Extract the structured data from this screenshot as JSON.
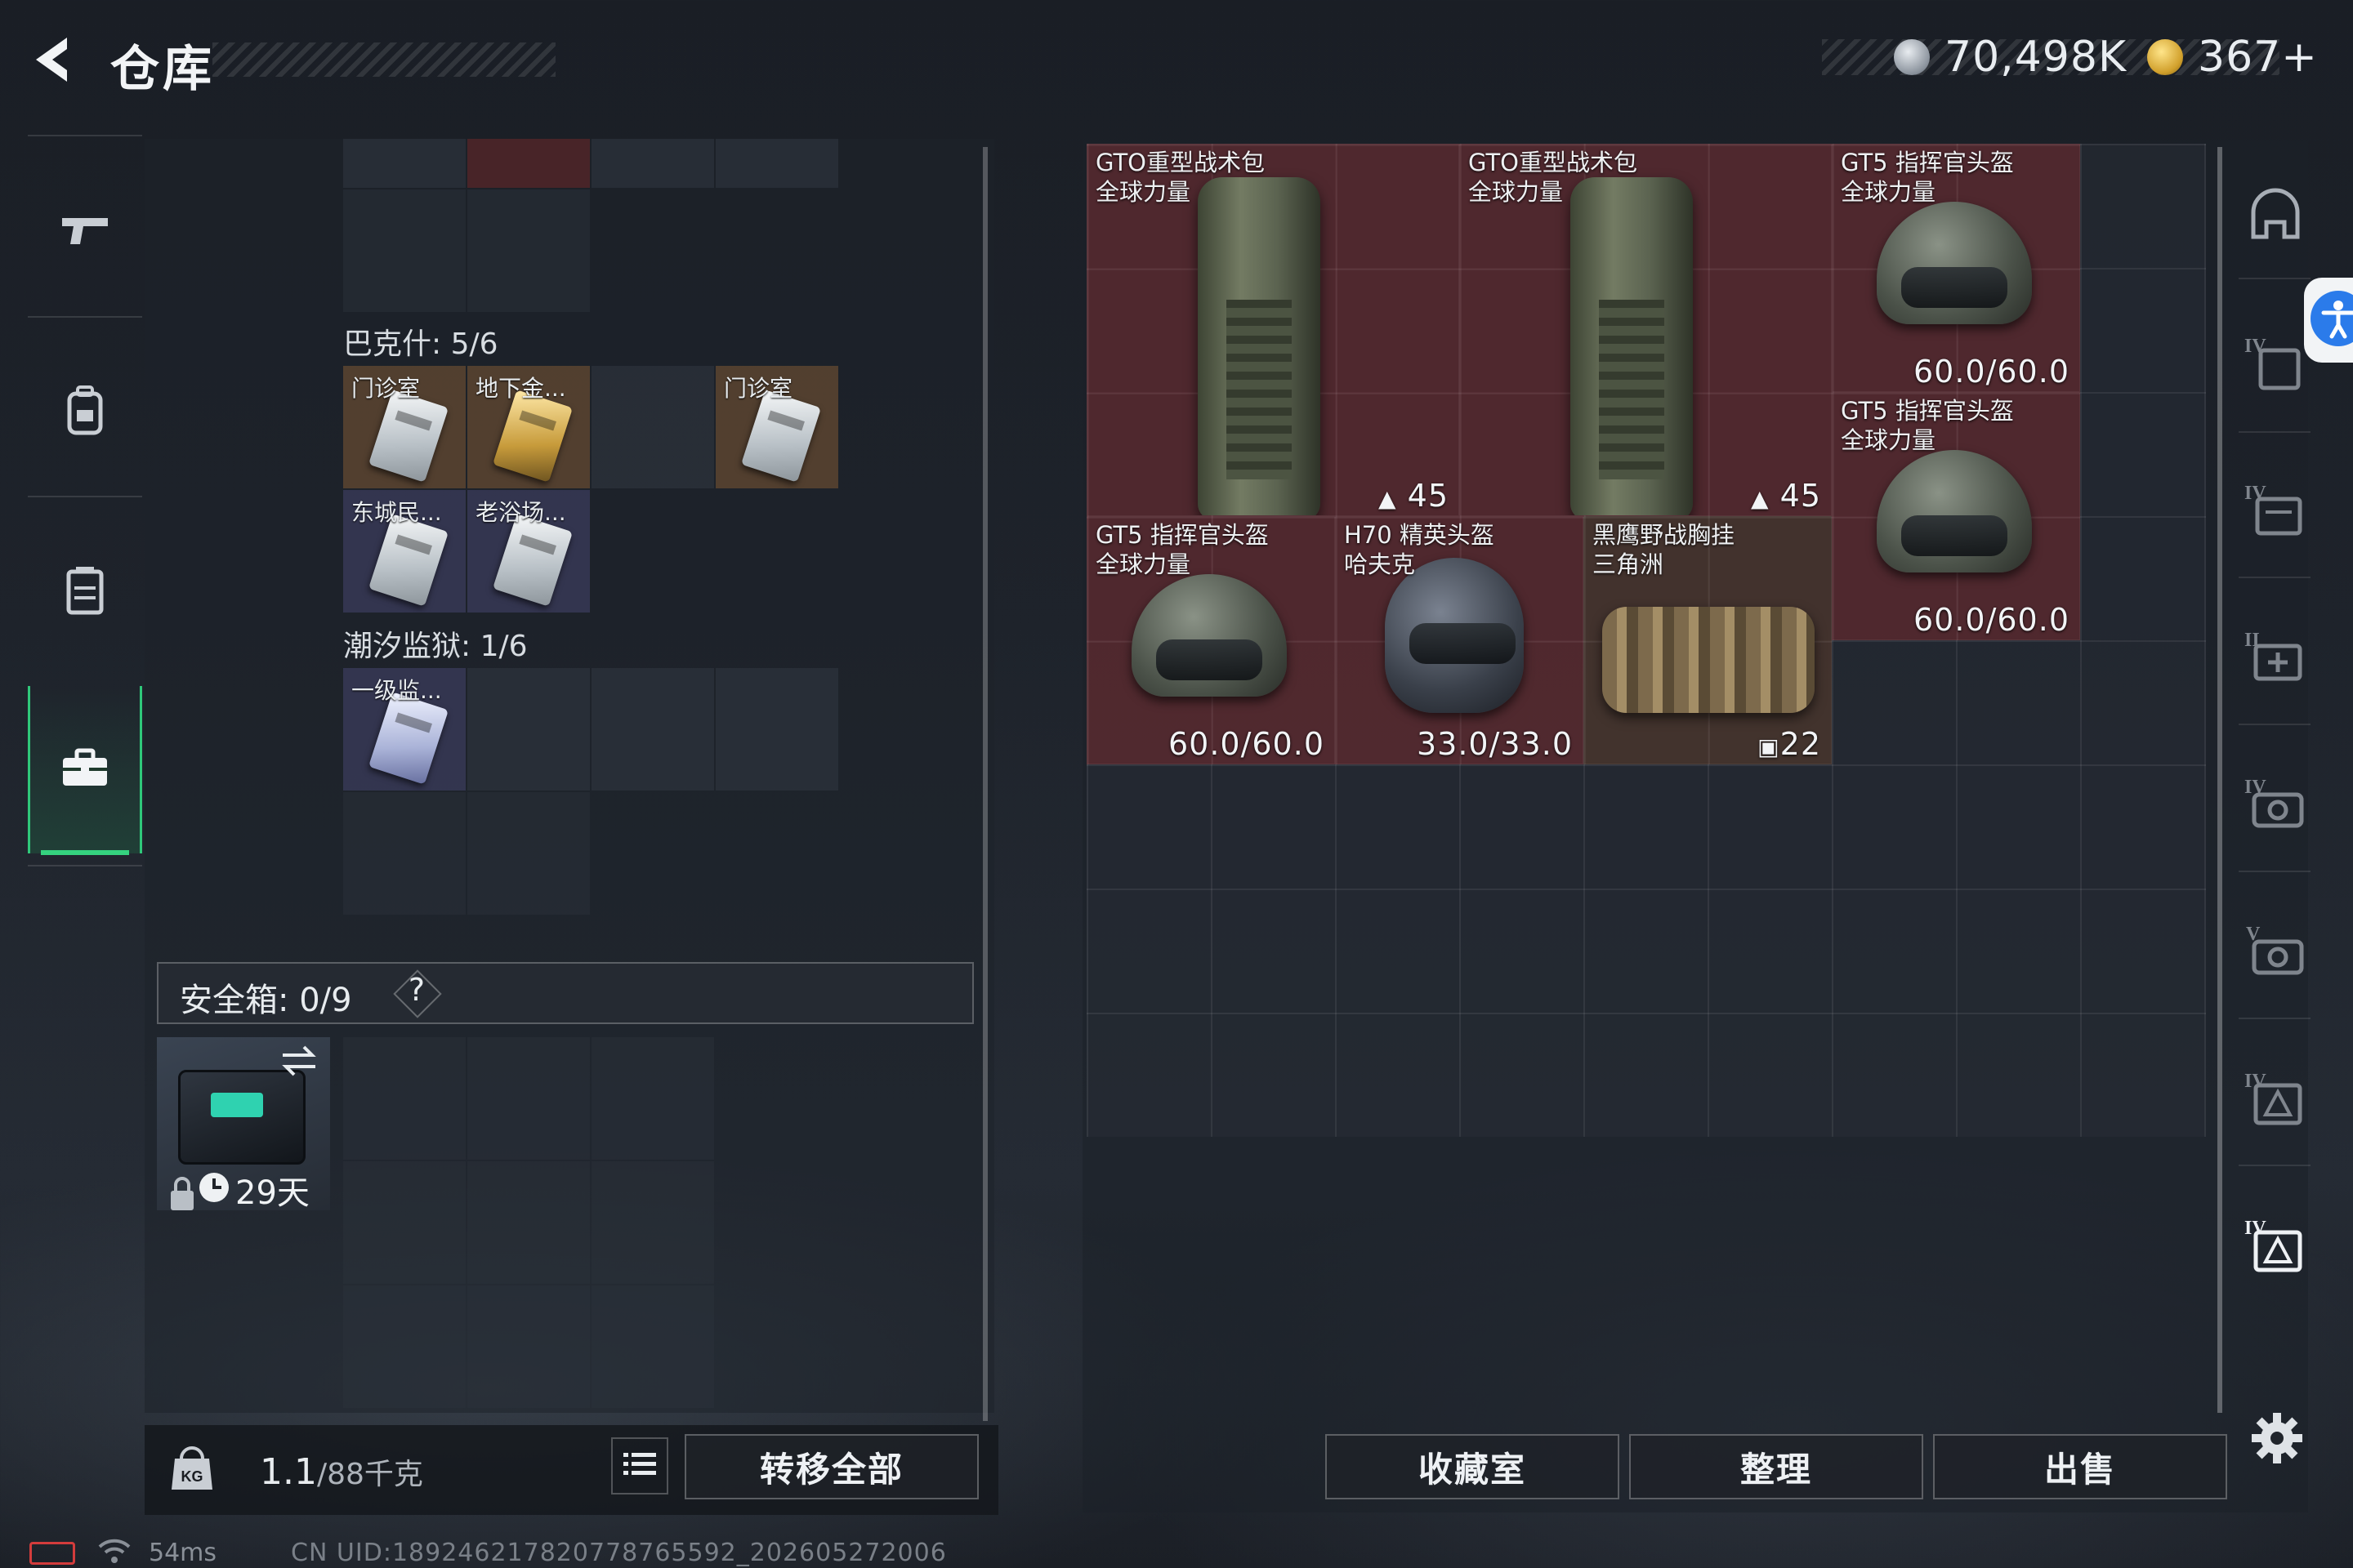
{
  "header": {
    "title": "仓库",
    "currency1": "70,498K",
    "currency2": "367+"
  },
  "nav": {
    "items": [
      {
        "icon": "pistol-icon"
      },
      {
        "icon": "backpack-icon"
      },
      {
        "icon": "vest-icon"
      },
      {
        "icon": "briefcase-icon",
        "selected": true
      }
    ]
  },
  "keys": {
    "section_bakshi": "巴克什: 5/6",
    "section_prison": "潮汐监狱: 1/6",
    "bakshi_items": [
      "门诊室",
      "地下金...",
      "",
      "门诊室",
      "东城民...",
      "老浴场..."
    ],
    "prison_items": [
      "一级监..."
    ]
  },
  "safe": {
    "label": "安全箱: 0/9",
    "help": "?",
    "days": "29天"
  },
  "footer_left": {
    "weight": "1.1",
    "weight_max": "/88千克",
    "transfer_all": "转移全部"
  },
  "stash": {
    "items": [
      {
        "name": "GTO重型战术包\n全球力量",
        "value": "45",
        "value_icon": "capacity-icon"
      },
      {
        "name": "GTO重型战术包\n全球力量",
        "value": "45",
        "value_icon": "capacity-icon"
      },
      {
        "name": "GT5 指挥官头盔\n全球力量",
        "value": "60.0/60.0"
      },
      {
        "name": "GT5 指挥官头盔\n全球力量",
        "value": "60.0/60.0"
      },
      {
        "name": "GT5 指挥官头盔\n全球力量",
        "value": "60.0/60.0"
      },
      {
        "name": "H70 精英头盔\n哈夫克",
        "value": "33.0/33.0"
      },
      {
        "name": "黑鹰野战胸挂\n三角洲",
        "value": "22",
        "value_icon": "vest-capacity-icon"
      }
    ]
  },
  "right_tabs": [
    "helmet-tab-icon",
    "armor-iv-icon",
    "chest-rig-iv-icon",
    "medkit-ii-icon",
    "camera-iv-icon",
    "camera-v-icon",
    "triangle-iv-icon",
    "triangle-iv-selected-icon"
  ],
  "footer_right": {
    "collection": "收藏室",
    "sort": "整理",
    "sell": "出售"
  },
  "status": {
    "ping": "54ms",
    "uid": "CN UID:189246217820778765592_202605272006"
  },
  "colors": {
    "accent_green": "#35d27f",
    "item_red": "#692a2e",
    "accessibility_blue": "#2b7bea"
  }
}
